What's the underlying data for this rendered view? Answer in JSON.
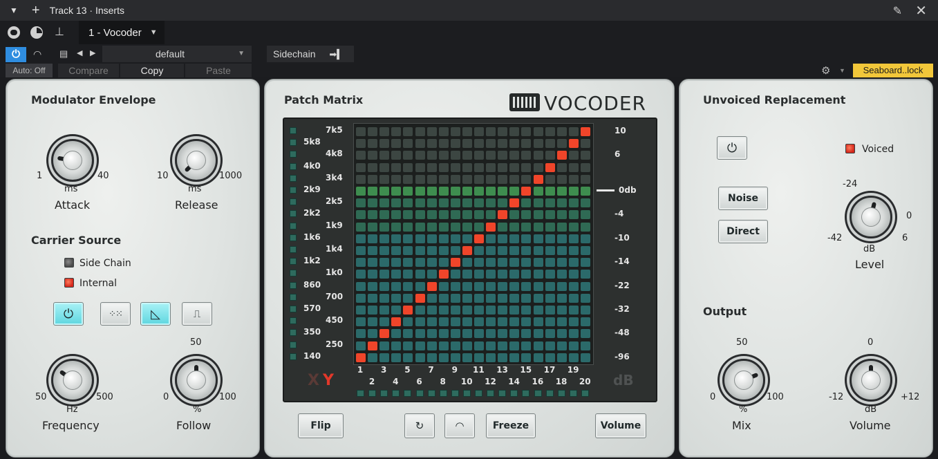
{
  "window": {
    "title": "Track 13 · Inserts",
    "instance_tab": "1 - Vocoder"
  },
  "toolbar": {
    "preset": "default",
    "sidechain_label": "Sidechain",
    "auto": "Auto: Off",
    "compare": "Compare",
    "copy": "Copy",
    "paste": "Paste",
    "device_label": "Seaboard..lock",
    "accent_color": "#2f8de0",
    "device_color": "#f2c73a"
  },
  "modulator": {
    "title": "Modulator Envelope",
    "attack": {
      "min": "1",
      "max": "40",
      "unit": "ms",
      "label": "Attack",
      "level": 0.2
    },
    "release": {
      "min": "10",
      "max": "1000",
      "unit": "ms",
      "label": "Release",
      "level": 0.0
    }
  },
  "carrier": {
    "title": "Carrier Source",
    "side_chain": "Side Chain",
    "internal": "Internal",
    "mode_icons": [
      "power-icon",
      "noise-icon",
      "saw-icon",
      "pulse-icon"
    ],
    "selected_modes": [
      "power-icon",
      "saw-icon"
    ],
    "frequency": {
      "min": "50",
      "max": "500",
      "unit": "Hz",
      "label": "Frequency",
      "level": 0.3
    },
    "follow": {
      "top": "50",
      "min": "0",
      "max": "100",
      "unit": "%",
      "label": "Follow",
      "level": 0.5
    }
  },
  "matrix": {
    "title": "Patch Matrix",
    "brand": "VOCODER",
    "freqs_left": [
      "7k5",
      "5k8",
      "4k8",
      "4k0",
      "3k4",
      "2k9",
      "2k5",
      "2k2",
      "1k9",
      "1k6",
      "1k4",
      "1k2",
      "1k0",
      "860",
      "700",
      "570",
      "450",
      "350",
      "250",
      "140"
    ],
    "db_labels": [
      "10",
      "6",
      "0db",
      "-4",
      "-10",
      "-14",
      "-22",
      "-32",
      "-48",
      "-96"
    ],
    "col_numbers_top": [
      "1",
      "3",
      "5",
      "7",
      "9",
      "11",
      "13",
      "15",
      "17",
      "19"
    ],
    "col_numbers_bottom": [
      "2",
      "4",
      "6",
      "8",
      "10",
      "12",
      "14",
      "16",
      "18",
      "20"
    ],
    "x_label": "X",
    "y_label": "Y",
    "db_unit": "dB",
    "active_diagonal": true,
    "highlight_row_label": "2k9"
  },
  "matrix_buttons": {
    "flip": "Flip",
    "freeze": "Freeze",
    "volume": "Volume",
    "reset_icon": "reset-icon",
    "arc_icon": "arc-icon"
  },
  "unvoiced": {
    "title": "Unvoiced Replacement",
    "voiced": "Voiced",
    "noise": "Noise",
    "direct": "Direct",
    "level": {
      "top": "-24",
      "right": "0",
      "min": "-42",
      "max": "6",
      "unit": "dB",
      "label": "Level",
      "level": 0.55
    }
  },
  "output": {
    "title": "Output",
    "mix": {
      "top": "50",
      "min": "0",
      "max": "100",
      "unit": "%",
      "label": "Mix",
      "level": 0.75
    },
    "volume": {
      "top": "0",
      "min": "-12",
      "max": "+12",
      "unit": "dB",
      "label": "Volume",
      "level": 0.5
    }
  }
}
